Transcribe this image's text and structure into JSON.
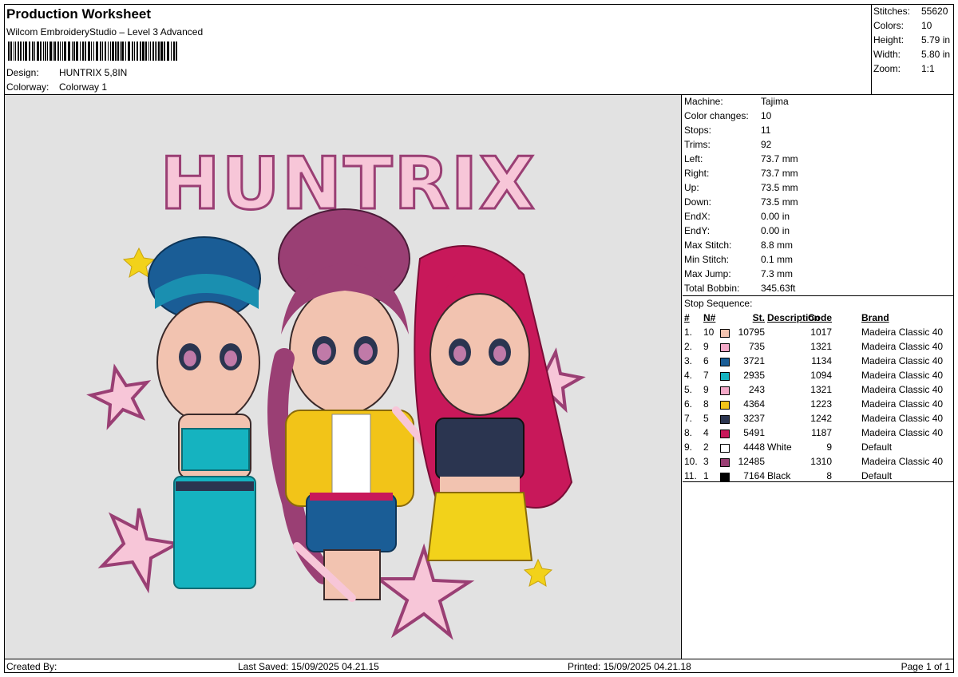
{
  "header": {
    "title": "Production Worksheet",
    "software": "Wilcom EmbroideryStudio – Level 3 Advanced",
    "design_label": "Design:",
    "design_value": "HUNTRIX 5,8IN",
    "colorway_label": "Colorway:",
    "colorway_value": "Colorway 1"
  },
  "summary": {
    "stitches_label": "Stitches:",
    "stitches_value": "55620",
    "colors_label": "Colors:",
    "colors_value": "10",
    "height_label": "Height:",
    "height_value": "5.79 in",
    "width_label": "Width:",
    "width_value": "5.80 in",
    "zoom_label": "Zoom:",
    "zoom_value": "1:1"
  },
  "props": [
    {
      "k": "Machine:",
      "v": "Tajima"
    },
    {
      "k": "Color changes:",
      "v": "10"
    },
    {
      "k": "Stops:",
      "v": "11"
    },
    {
      "k": "Trims:",
      "v": "92"
    },
    {
      "k": "Left:",
      "v": "73.7 mm"
    },
    {
      "k": "Right:",
      "v": "73.7 mm"
    },
    {
      "k": "Up:",
      "v": "73.5 mm"
    },
    {
      "k": "Down:",
      "v": "73.5 mm"
    },
    {
      "k": "EndX:",
      "v": "0.00 in"
    },
    {
      "k": "EndY:",
      "v": "0.00 in"
    },
    {
      "k": "Max Stitch:",
      "v": "8.8 mm"
    },
    {
      "k": "Min Stitch:",
      "v": "0.1 mm"
    },
    {
      "k": "Max Jump:",
      "v": "7.3 mm"
    },
    {
      "k": "Total Bobbin:",
      "v": "345.63ft"
    }
  ],
  "sequence": {
    "title": "Stop Sequence:",
    "columns": {
      "num": "#",
      "n": "N#",
      "st": "St.",
      "desc": "Description",
      "code": "Code",
      "brand": "Brand"
    },
    "rows": [
      {
        "num": "1.",
        "n": "10",
        "color": "#f2c3b0",
        "st": "10795",
        "desc": "",
        "code": "1017",
        "brand": "Madeira Classic 40"
      },
      {
        "num": "2.",
        "n": "9",
        "color": "#f4a9c8",
        "st": "735",
        "desc": "",
        "code": "1321",
        "brand": "Madeira Classic 40"
      },
      {
        "num": "3.",
        "n": "6",
        "color": "#1a5d96",
        "st": "3721",
        "desc": "",
        "code": "1134",
        "brand": "Madeira Classic 40"
      },
      {
        "num": "4.",
        "n": "7",
        "color": "#15b3c0",
        "st": "2935",
        "desc": "",
        "code": "1094",
        "brand": "Madeira Classic 40"
      },
      {
        "num": "5.",
        "n": "9",
        "color": "#f4a9c8",
        "st": "243",
        "desc": "",
        "code": "1321",
        "brand": "Madeira Classic 40"
      },
      {
        "num": "6.",
        "n": "8",
        "color": "#f2c418",
        "st": "4364",
        "desc": "",
        "code": "1223",
        "brand": "Madeira Classic 40"
      },
      {
        "num": "7.",
        "n": "5",
        "color": "#2b3550",
        "st": "3237",
        "desc": "",
        "code": "1242",
        "brand": "Madeira Classic 40"
      },
      {
        "num": "8.",
        "n": "4",
        "color": "#c8185a",
        "st": "5491",
        "desc": "",
        "code": "1187",
        "brand": "Madeira Classic 40"
      },
      {
        "num": "9.",
        "n": "2",
        "color": "#ffffff",
        "st": "4448",
        "desc": "White",
        "code": "9",
        "brand": "Default"
      },
      {
        "num": "10.",
        "n": "3",
        "color": "#9a3f74",
        "st": "12485",
        "desc": "",
        "code": "1310",
        "brand": "Madeira Classic 40"
      },
      {
        "num": "11.",
        "n": "1",
        "color": "#000000",
        "st": "7164",
        "desc": "Black",
        "code": "8",
        "brand": "Default"
      }
    ]
  },
  "preview": {
    "logo_text": "HUNTRIX"
  },
  "footer": {
    "created_by": "Created By:",
    "last_saved": "Last Saved: 15/09/2025 04.21.15",
    "printed": "Printed: 15/09/2025 04.21.18",
    "page": "Page 1 of 1"
  }
}
